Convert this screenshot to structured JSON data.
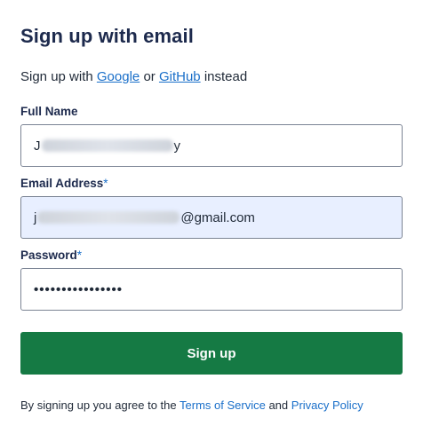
{
  "form": {
    "title": "Sign up with email",
    "alt_prefix": "Sign up with",
    "google_link": "Google",
    "alt_or": "or",
    "github_link": "GitHub",
    "alt_suffix": "instead"
  },
  "fields": {
    "full_name": {
      "label": "Full Name",
      "value_start": "J",
      "value_end": "y"
    },
    "email": {
      "label": "Email Address",
      "required_mark": "*",
      "value_start": "j",
      "value_end": "@gmail.com"
    },
    "password": {
      "label": "Password",
      "required_mark": "*",
      "masked_value": "••••••••••••••••"
    }
  },
  "submit": {
    "label": "Sign up"
  },
  "terms": {
    "prefix": "By signing up you agree to the",
    "tos_link": "Terms of Service",
    "and": "and",
    "privacy_link": "Privacy Policy"
  },
  "colors": {
    "accent": "#157a44",
    "link": "#1a6fc9",
    "autofill_bg": "#e8efff"
  }
}
